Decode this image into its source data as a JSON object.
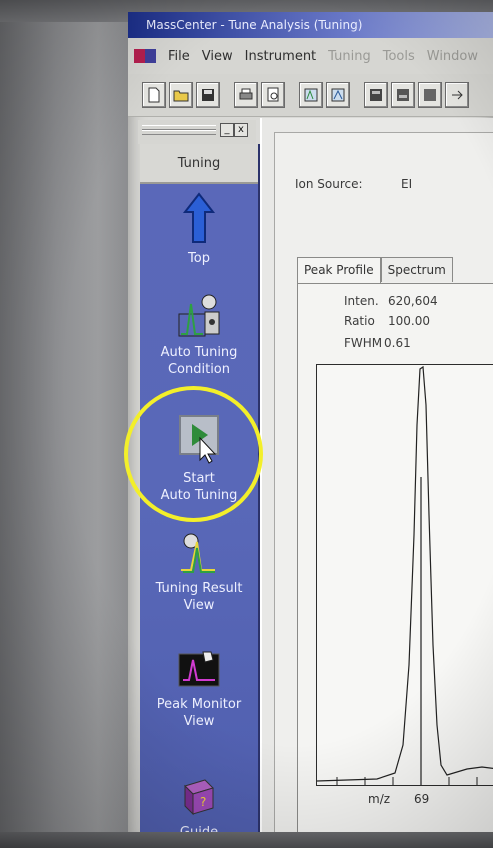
{
  "window": {
    "title": "MassCenter - Tune Analysis (Tuning)"
  },
  "menu": [
    "File",
    "View",
    "Instrument",
    "Tuning",
    "Tools",
    "Window"
  ],
  "toolbar": {
    "icons": [
      "new-file-icon",
      "open-folder-icon",
      "save-icon",
      "print-icon",
      "print-preview-icon",
      "tune-a-icon",
      "tune-b-icon",
      "layout-a-icon",
      "layout-b-icon",
      "layout-c-icon",
      "arrow-icon"
    ]
  },
  "dock": {
    "minimize_label": "_",
    "close_label": "x"
  },
  "tuning_panel": {
    "header": "Tuning",
    "tools": [
      {
        "label_line1": "Top",
        "label_line2": ""
      },
      {
        "label_line1": "Auto Tuning",
        "label_line2": "Condition"
      },
      {
        "label_line1": "Start",
        "label_line2": "Auto Tuning"
      },
      {
        "label_line1": "Tuning Result",
        "label_line2": "View"
      },
      {
        "label_line1": "Peak Monitor",
        "label_line2": "View"
      },
      {
        "label_line1": "Guide",
        "label_line2": ""
      }
    ]
  },
  "main": {
    "ion_source_label": "Ion Source:",
    "ion_source_value": "EI",
    "tabs": [
      "Peak Profile",
      "Spectrum"
    ],
    "stats": {
      "inten_label": "Inten.",
      "inten_value": "620,604",
      "ratio_label": "Ratio",
      "ratio_value": "100.00",
      "fwhm_label": "FWHM",
      "fwhm_value": "0.61"
    },
    "mz_label": "m/z",
    "mz_value": "69"
  },
  "colors": {
    "panel_blue": "#5968b8",
    "highlight": "#f3ef2a",
    "play_green": "#2e8b3a"
  }
}
